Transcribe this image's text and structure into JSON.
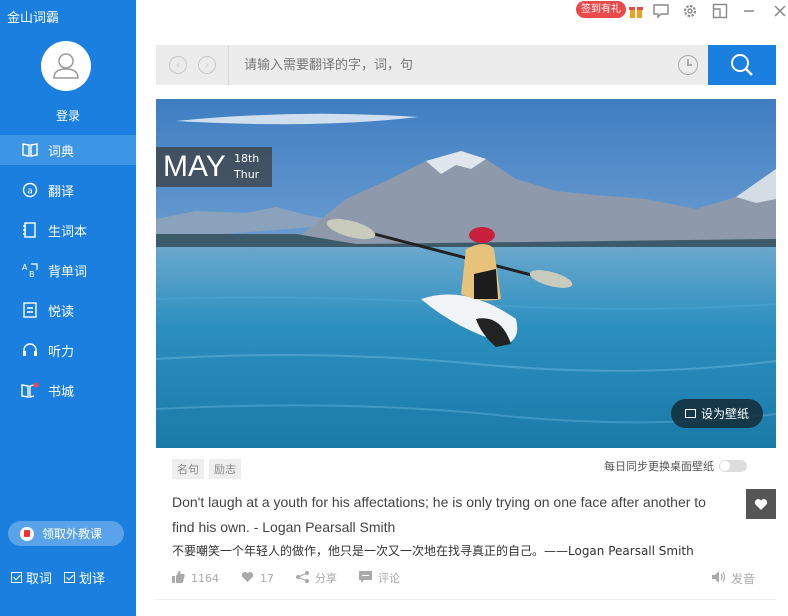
{
  "app": {
    "title": "金山词霸"
  },
  "sidebar": {
    "login_label": "登录",
    "items": [
      {
        "label": "词典",
        "icon": "book-icon",
        "active": true
      },
      {
        "label": "翻译",
        "icon": "translate-icon",
        "active": false
      },
      {
        "label": "生词本",
        "icon": "notebook-icon",
        "active": false
      },
      {
        "label": "背单词",
        "icon": "flashcard-icon",
        "active": false
      },
      {
        "label": "悦读",
        "icon": "reading-icon",
        "active": false
      },
      {
        "label": "听力",
        "icon": "headphones-icon",
        "active": false
      },
      {
        "label": "书城",
        "icon": "bookstore-icon",
        "active": false
      }
    ],
    "promo_label": "领取外教课",
    "check_lookup": "取词",
    "check_select": "划译"
  },
  "titlebar": {
    "sign_label": "签到有礼"
  },
  "search": {
    "placeholder": "请输入需要翻译的字，词，句"
  },
  "hero": {
    "month": "MAY",
    "day": "18th",
    "weekday": "Thur",
    "wallpaper_label": "设为壁纸"
  },
  "card": {
    "tags": [
      "名句",
      "励志"
    ],
    "sync_label": "每日同步更换桌面壁纸",
    "quote_en": "Don't laugh at a youth for his affectations; he is only trying on one face after another to find his own. - Logan Pearsall Smith",
    "quote_zh": "不要嘲笑一个年轻人的做作，他只是一次又一次地在找寻真正的自己。——Logan Pearsall Smith",
    "likes": "1164",
    "favorites": "17",
    "share_label": "分享",
    "comment_label": "评论",
    "voice_label": "发音"
  },
  "colors": {
    "brand": "#1a7fde",
    "badge": "#e94a4a"
  }
}
